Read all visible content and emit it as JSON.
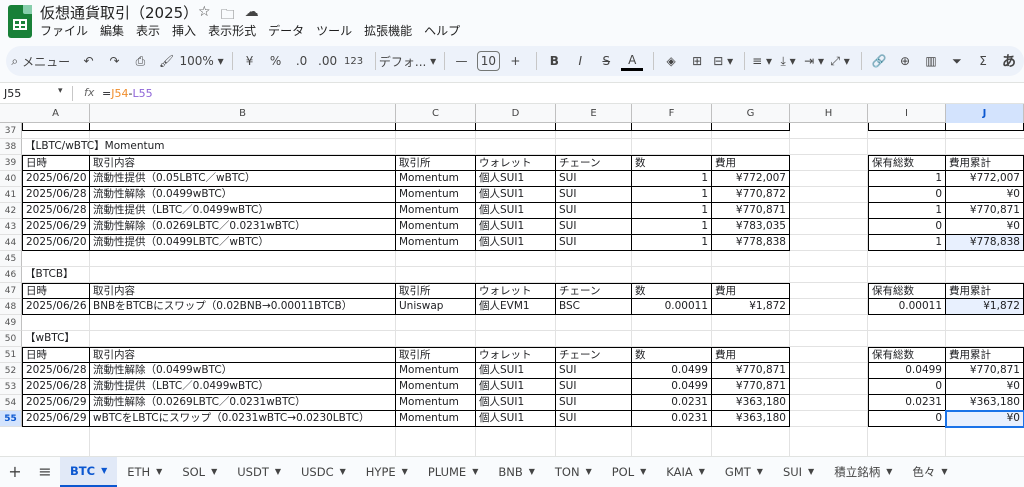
{
  "app": {
    "title": "仮想通貨取引（2025）",
    "brand_color": "#188038"
  },
  "menu": [
    "ファイル",
    "編集",
    "表示",
    "挿入",
    "表示形式",
    "データ",
    "ツール",
    "拡張機能",
    "ヘルプ"
  ],
  "toolbar": {
    "search": "メニュー",
    "zoom": "100%",
    "currency": "¥",
    "percent": "%",
    "dec_down": ".0",
    "dec_up": ".00",
    "num_format": "123",
    "font": "デフォ...",
    "font_size": "10",
    "font_size_minus": "—",
    "font_size_plus": "+",
    "bold": "B",
    "italic": "I",
    "strike": "S",
    "text_color": "A",
    "sum": "Σ",
    "input_tools": "あ"
  },
  "formula": {
    "namebox": "J55",
    "ref1": "J54",
    "op": "-",
    "ref2": "L55",
    "eq": "=",
    "fx": "fx"
  },
  "columns": [
    "A",
    "B",
    "C",
    "D",
    "E",
    "F",
    "G",
    "H",
    "I",
    "J"
  ],
  "rows": [
    {
      "n": "37",
      "cells": [
        "",
        "",
        "",
        "",
        "",
        "",
        "",
        "",
        "",
        ""
      ],
      "kind": "cut"
    },
    {
      "n": "38",
      "cells": [
        "【LBTC/wBTC】Momentum",
        "",
        "",
        "",
        "",
        "",
        "",
        "",
        "",
        ""
      ],
      "kind": "title"
    },
    {
      "n": "39",
      "cells": [
        "日時",
        "取引内容",
        "取引所",
        "ウォレット",
        "チェーン",
        "数",
        "費用",
        "",
        "保有総数",
        "費用累計"
      ],
      "kind": "header"
    },
    {
      "n": "40",
      "cells": [
        "2025/06/20",
        "流動性提供（0.05LBTC／wBTC）",
        "Momentum",
        "個人SUI1",
        "SUI",
        "1",
        "¥772,007",
        "",
        "1",
        "¥772,007"
      ],
      "kind": "data"
    },
    {
      "n": "41",
      "cells": [
        "2025/06/28",
        "流動性解除（0.0499wBTC）",
        "Momentum",
        "個人SUI1",
        "SUI",
        "1",
        "¥770,872",
        "",
        "0",
        "¥0"
      ],
      "kind": "data"
    },
    {
      "n": "42",
      "cells": [
        "2025/06/28",
        "流動性提供（LBTC／0.0499wBTC）",
        "Momentum",
        "個人SUI1",
        "SUI",
        "1",
        "¥770,871",
        "",
        "1",
        "¥770,871"
      ],
      "kind": "data"
    },
    {
      "n": "43",
      "cells": [
        "2025/06/29",
        "流動性解除（0.0269LBTC／0.0231wBTC）",
        "Momentum",
        "個人SUI1",
        "SUI",
        "1",
        "¥783,035",
        "",
        "0",
        "¥0"
      ],
      "kind": "data"
    },
    {
      "n": "44",
      "cells": [
        "2025/06/20",
        "流動性提供（0.0499LBTC／wBTC）",
        "Momentum",
        "個人SUI1",
        "SUI",
        "1",
        "¥778,838",
        "",
        "1",
        "¥778,838"
      ],
      "kind": "data"
    },
    {
      "n": "45",
      "cells": [
        "",
        "",
        "",
        "",
        "",
        "",
        "",
        "",
        "",
        ""
      ],
      "kind": "empty"
    },
    {
      "n": "46",
      "cells": [
        "【BTCB】",
        "",
        "",
        "",
        "",
        "",
        "",
        "",
        "",
        ""
      ],
      "kind": "title"
    },
    {
      "n": "47",
      "cells": [
        "日時",
        "取引内容",
        "取引所",
        "ウォレット",
        "チェーン",
        "数",
        "費用",
        "",
        "保有総数",
        "費用累計"
      ],
      "kind": "header"
    },
    {
      "n": "48",
      "cells": [
        "2025/06/26",
        "BNBをBTCBにスワップ（0.02BNB→0.00011BTCB）",
        "Uniswap",
        "個人EVM1",
        "BSC",
        "0.00011",
        "¥1,872",
        "",
        "0.00011",
        "¥1,872"
      ],
      "kind": "data"
    },
    {
      "n": "49",
      "cells": [
        "",
        "",
        "",
        "",
        "",
        "",
        "",
        "",
        "",
        ""
      ],
      "kind": "empty"
    },
    {
      "n": "50",
      "cells": [
        "【wBTC】",
        "",
        "",
        "",
        "",
        "",
        "",
        "",
        "",
        ""
      ],
      "kind": "title"
    },
    {
      "n": "51",
      "cells": [
        "日時",
        "取引内容",
        "取引所",
        "ウォレット",
        "チェーン",
        "数",
        "費用",
        "",
        "保有総数",
        "費用累計"
      ],
      "kind": "header"
    },
    {
      "n": "52",
      "cells": [
        "2025/06/28",
        "流動性解除（0.0499wBTC）",
        "Momentum",
        "個人SUI1",
        "SUI",
        "0.0499",
        "¥770,871",
        "",
        "0.0499",
        "¥770,871"
      ],
      "kind": "data"
    },
    {
      "n": "53",
      "cells": [
        "2025/06/28",
        "流動性提供（LBTC／0.0499wBTC）",
        "Momentum",
        "個人SUI1",
        "SUI",
        "0.0499",
        "¥770,871",
        "",
        "0",
        "¥0"
      ],
      "kind": "data"
    },
    {
      "n": "54",
      "cells": [
        "2025/06/29",
        "流動性解除（0.0269LBTC／0.0231wBTC）",
        "Momentum",
        "個人SUI1",
        "SUI",
        "0.0231",
        "¥363,180",
        "",
        "0.0231",
        "¥363,180"
      ],
      "kind": "data"
    },
    {
      "n": "55",
      "cells": [
        "2025/06/29",
        "wBTCをLBTCにスワップ（0.0231wBTC→0.0230LBTC）",
        "Momentum",
        "個人SUI1",
        "SUI",
        "0.0231",
        "¥363,180",
        "",
        "0",
        "¥0"
      ],
      "kind": "data"
    }
  ],
  "selected_cell": {
    "col": "J",
    "row": "55"
  },
  "sheet_tabs": [
    "BTC",
    "ETH",
    "SOL",
    "USDT",
    "USDC",
    "HYPE",
    "PLUME",
    "BNB",
    "TON",
    "POL",
    "KAIA",
    "GMT",
    "SUI",
    "積立銘柄",
    "色々"
  ],
  "active_tab": "BTC",
  "colors": {
    "selection": "#1a73e8",
    "selected_header": "#d3e3fd",
    "active_tab": "#0b57d0"
  }
}
